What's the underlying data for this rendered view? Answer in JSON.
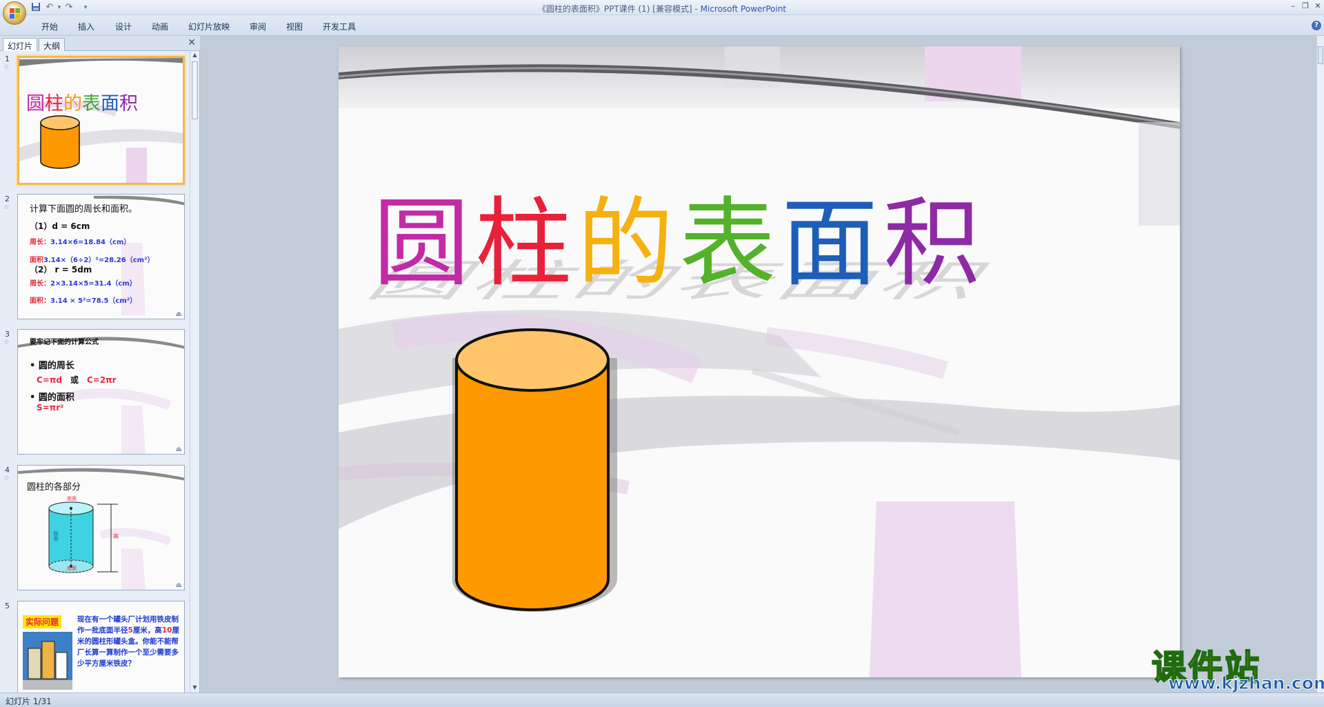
{
  "window": {
    "title_doc": "《圆柱的表面积》PPT课件 (1) [兼容模式]",
    "title_sep": " - ",
    "title_app": "Microsoft PowerPoint",
    "min_glyph": "–",
    "restore_glyph": "❐",
    "close_glyph": "✕"
  },
  "quick_access": {
    "save_icon": "save-icon",
    "undo_glyph": "↶",
    "redo_glyph": "↷",
    "more_glyph": "▾",
    "save_glyph": "💾"
  },
  "ribbon": {
    "tabs": [
      "开始",
      "插入",
      "设计",
      "动画",
      "幻灯片放映",
      "审阅",
      "视图",
      "开发工具"
    ],
    "help_glyph": "?"
  },
  "panel": {
    "tab_slides": "幻灯片",
    "tab_outline": "大纲",
    "close_glyph": "✕",
    "up_glyph": "▲",
    "down_glyph": "▼"
  },
  "thumbnails": [
    {
      "num": "1",
      "title": "圆柱的表面积"
    },
    {
      "num": "2",
      "title": "计算下面圆的周长和面积。",
      "line1": "（1）d = 6cm",
      "line2a": "周长：",
      "line2b": "3.14×6=18.84（cm）",
      "line3a": "面积",
      "line3b": "3.14×（6÷2）²=28.26（cm²）",
      "line4": "（2）  r = 5dm",
      "line5a": "周长：",
      "line5b": "2×3.14×5=31.4（cm）",
      "line6a": "面积：",
      "line6b": "3.14 × 5²=78.5（cm²）"
    },
    {
      "num": "3",
      "title": "要牢记下面的计算公式",
      "b1": "圆的周长",
      "f1": "C=πd",
      "or": "或",
      "f2": "C=2πr",
      "b2": "圆的面积",
      "f3": "S=πr²"
    },
    {
      "num": "4",
      "title": "圆柱的各部分",
      "lbl_top": "底面",
      "lbl_side": "侧面",
      "lbl_h": "高",
      "lbl_bottom": "底面"
    },
    {
      "num": "5",
      "badge": "实际问题",
      "p1a": "现在有一个罐头厂计划用铁皮制作一批底面半径",
      "p1b": "5",
      "p1c": "厘米，高",
      "p1d": "10",
      "p1e": "厘米的圆柱形罐头盒。你能不能帮厂长算一算制作一个至少需要多少平方厘米铁皮？"
    }
  ],
  "slide": {
    "title_chars": [
      "圆",
      "柱",
      "的",
      "表",
      "面",
      "积"
    ],
    "title_colors": [
      "#c22aa6",
      "#e8203a",
      "#f29a12",
      "#3aa632",
      "#1d5fb8",
      "#8e2aa6"
    ]
  },
  "status": {
    "text": "幻灯片 1/31"
  },
  "watermark": {
    "big": "课件站",
    "small": "www.kjzhan.com"
  }
}
